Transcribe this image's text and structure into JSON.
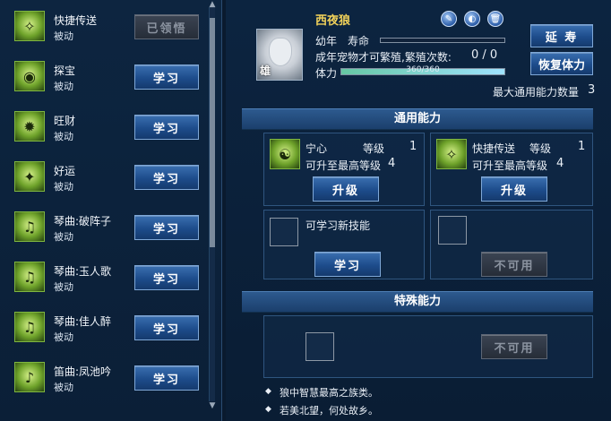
{
  "skill_list": [
    {
      "name": "快捷传送",
      "type": "被动",
      "button": "已领悟",
      "disabled": true,
      "icon": "teleport-icon"
    },
    {
      "name": "探宝",
      "type": "被动",
      "button": "学习",
      "disabled": false,
      "icon": "eye-icon"
    },
    {
      "name": "旺财",
      "type": "被动",
      "button": "学习",
      "disabled": false,
      "icon": "coins-icon"
    },
    {
      "name": "好运",
      "type": "被动",
      "button": "学习",
      "disabled": false,
      "icon": "luck-icon"
    },
    {
      "name": "琴曲:破阵子",
      "type": "被动",
      "button": "学习",
      "disabled": false,
      "icon": "music-icon"
    },
    {
      "name": "琴曲:玉人歌",
      "type": "被动",
      "button": "学习",
      "disabled": false,
      "icon": "music-icon"
    },
    {
      "name": "琴曲:佳人醉",
      "type": "被动",
      "button": "学习",
      "disabled": false,
      "icon": "music-icon"
    },
    {
      "name": "笛曲:凤池吟",
      "type": "被动",
      "button": "学习",
      "disabled": false,
      "icon": "flute-icon"
    }
  ],
  "pet": {
    "name": "西夜狼",
    "gender": "雄",
    "stage": "幼年",
    "lifespan_label": "寿命",
    "lifespan_fraction": 0.0,
    "breed_text": "成年宠物才可繁殖,繁殖次数:",
    "breed_count": "0 / 0",
    "stamina_label": "体力",
    "stamina_value": "360/360",
    "stamina_fraction": 1.0,
    "max_ability_label": "最大通用能力数量",
    "max_ability_value": "3"
  },
  "actions": {
    "extend": "延 寿",
    "restore": "恢复体力"
  },
  "general": {
    "title": "通用能力",
    "slots": [
      {
        "name": "宁心",
        "level_label": "等级",
        "level": "1",
        "max_text": "可升至最高等级",
        "max": "4",
        "button": "升级"
      },
      {
        "name": "快捷传送",
        "level_label": "等级",
        "level": "1",
        "max_text": "可升至最高等级",
        "max": "4",
        "button": "升级"
      }
    ],
    "learnable_text": "可学习新技能",
    "learn_button": "学习",
    "unavailable_button": "不可用"
  },
  "special": {
    "title": "特殊能力",
    "unavailable_button": "不可用"
  },
  "notes": [
    "狼中智慧最高之族类。",
    "若美北望，何处故乡。"
  ],
  "colors": {
    "accent": "#1d4c8b",
    "title_gold": "#f2d25a"
  }
}
